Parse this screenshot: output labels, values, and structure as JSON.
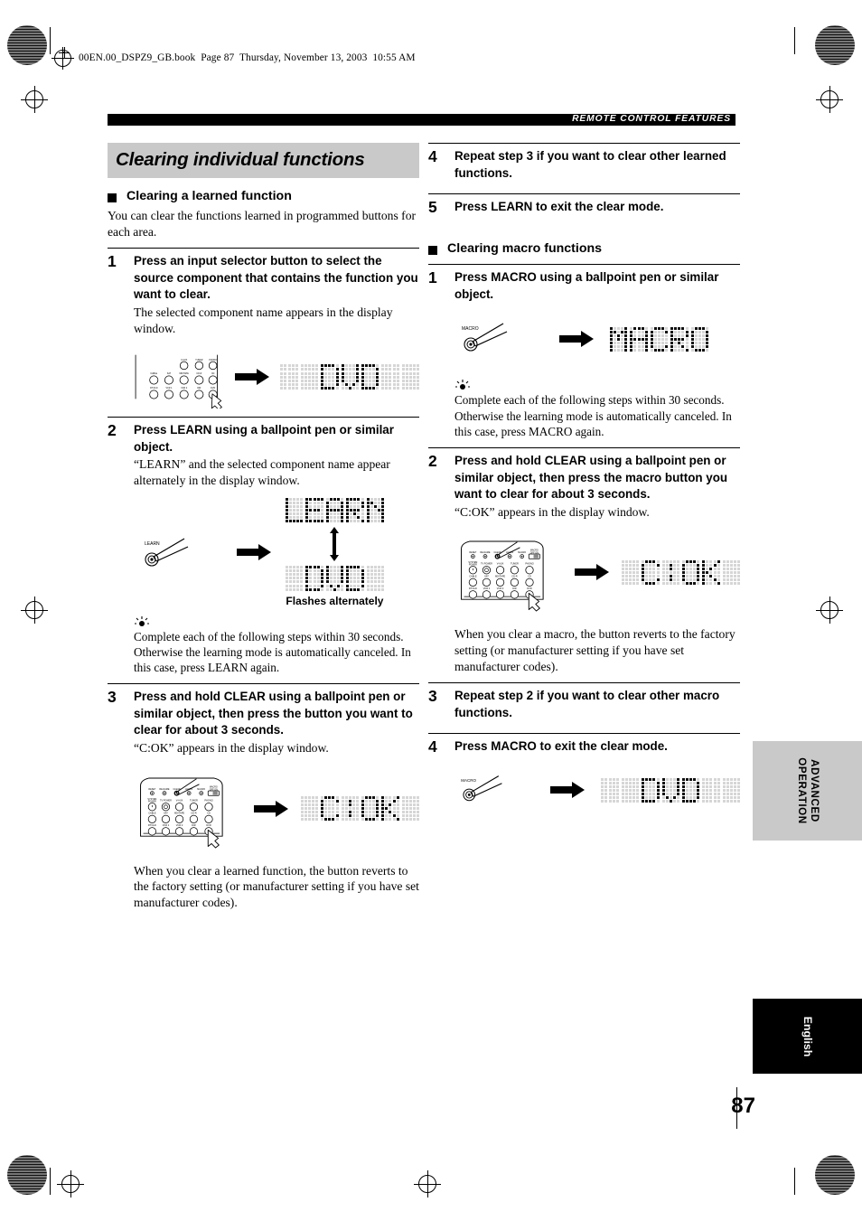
{
  "document": {
    "file_header": "00EN.00_DSPZ9_GB.book  Page 87  Thursday, November 13, 2003  10:55 AM",
    "running_head": "REMOTE CONTROL FEATURES",
    "page_number": "87",
    "side_tab_section": "ADVANCED\nOPERATION",
    "side_tab_language": "English"
  },
  "section": {
    "title": "Clearing individual functions"
  },
  "left_column": {
    "subhead": "Clearing a learned function",
    "intro": "You can clear the functions learned in programmed buttons for each area.",
    "steps": [
      {
        "num": "1",
        "title": "Press an input selector button to select the source component that contains the function you want to clear.",
        "sub": "The selected component name appears in the display window.",
        "figure": {
          "type": "remote-selector",
          "lcd": "DVD",
          "remote_labels_row1": [
            "V-AUX",
            "TUNER",
            "PHONO"
          ],
          "remote_labels_row2": [
            "CABLE",
            "SAT",
            "MD/TAPE",
            "CD-R",
            "CD"
          ],
          "remote_labels_row3": [
            "DTV/LD",
            "VCR 1",
            "VCR 2",
            "DIR",
            "DVD"
          ]
        }
      },
      {
        "num": "2",
        "title": "Press LEARN using a ballpoint pen or similar object.",
        "sub": "“LEARN” and the selected component name appear alternately in the display window.",
        "figure": {
          "type": "pen-press",
          "button_label": "LEARN",
          "lcd_top": "LEARN",
          "lcd_bottom": "DVD",
          "caption": "Flashes alternately"
        },
        "tip": "Complete each of the following steps within 30 seconds. Otherwise the learning mode is automatically canceled. In this case, press LEARN again."
      },
      {
        "num": "3",
        "title": "Press and hold CLEAR using a ballpoint pen or similar object, then press the button you want to clear for about 3 seconds.",
        "sub": "“C:OK” appears in the display window.",
        "figure": {
          "type": "remote-full",
          "lcd": "C:OK",
          "top_labels": [
            "RESET",
            "RE-NAME",
            "CLEAR",
            "LEARN",
            "MACRO"
          ],
          "switch_label": "MACRO\nOFF  ON",
          "remote_labels_row1": [
            "SYSTEM POWER",
            "TV POWER",
            "V-AUX",
            "TUNER",
            "PHONO"
          ],
          "remote_labels_row2": [
            "CABLE",
            "SAT",
            "MD/TAPE",
            "CD-R",
            "CD"
          ],
          "remote_labels_row3": [
            "DTV/LD",
            "VCR 1",
            "VCR 2",
            "DIR",
            "DVD"
          ]
        },
        "after": "When you clear a learned function, the button reverts to the factory setting (or manufacturer setting if you have set manufacturer codes)."
      }
    ]
  },
  "right_column": {
    "top_steps": [
      {
        "num": "4",
        "title": "Repeat step 3 if you want to clear other learned functions."
      },
      {
        "num": "5",
        "title": "Press LEARN to exit the clear mode."
      }
    ],
    "subhead": "Clearing macro functions",
    "steps": [
      {
        "num": "1",
        "title": "Press MACRO using a ballpoint pen or similar object.",
        "figure": {
          "type": "pen-press",
          "button_label": "MACRO",
          "lcd": "MACRO"
        },
        "tip": "Complete each of the following steps within 30 seconds. Otherwise the learning mode is automatically canceled. In this case, press MACRO again."
      },
      {
        "num": "2",
        "title": "Press and hold CLEAR using a ballpoint pen or similar object, then press the macro button you want to clear for about 3 seconds.",
        "sub": "“C:OK” appears in the display window.",
        "figure": {
          "type": "remote-full",
          "lcd": "C:OK",
          "top_labels": [
            "RESET",
            "RE-NAME",
            "CLEAR",
            "LEARN",
            "MACRO"
          ],
          "switch_label": "MACRO\nOFF  ON",
          "remote_labels_row1": [
            "SYSTEM POWER",
            "TV POWER",
            "V-AUX",
            "TUNER",
            "PHONO"
          ],
          "remote_labels_row2": [
            "CABLE",
            "SAT",
            "MD/TAPE",
            "CD-R",
            "CD"
          ],
          "remote_labels_row3": [
            "DTV/LD",
            "VCR 1",
            "VCR 2",
            "DIR",
            "DVD"
          ]
        },
        "after": "When you clear a macro, the button reverts to the factory setting (or manufacturer setting if you have set manufacturer codes)."
      },
      {
        "num": "3",
        "title": "Repeat step 2 if you want to clear other macro functions."
      },
      {
        "num": "4",
        "title": "Press MACRO to exit the clear mode.",
        "figure": {
          "type": "pen-press",
          "button_label": "MACRO",
          "lcd": "DVD"
        }
      }
    ]
  },
  "colors": {
    "title_band": "#c9c9c9",
    "running_head_bg": "#000000",
    "lcd_off": "#d6d6d6",
    "lcd_on": "#111111"
  }
}
